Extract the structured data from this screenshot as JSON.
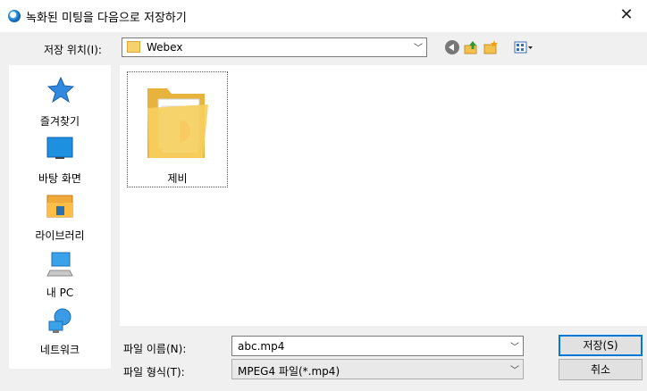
{
  "window": {
    "title": "녹화된 미팅을 다음으로 저장하기",
    "close": "✕"
  },
  "location": {
    "label": "저장 위치(I):",
    "value": "Webex"
  },
  "places": [
    {
      "label": "즐겨찾기",
      "icon": "star-icon"
    },
    {
      "label": "바탕 화면",
      "icon": "desktop-icon"
    },
    {
      "label": "라이브러리",
      "icon": "library-icon"
    },
    {
      "label": "내 PC",
      "icon": "computer-icon"
    },
    {
      "label": "네트워크",
      "icon": "network-icon"
    }
  ],
  "files": [
    {
      "label": "제비",
      "icon": "folder-icon"
    }
  ],
  "filename": {
    "label": "파일 이름(N):",
    "value": "abc.mp4"
  },
  "filetype": {
    "label": "파일 형식(T):",
    "value": "MPEG4 파일(*.mp4)"
  },
  "buttons": {
    "save": "저장(S)",
    "cancel": "취소"
  }
}
